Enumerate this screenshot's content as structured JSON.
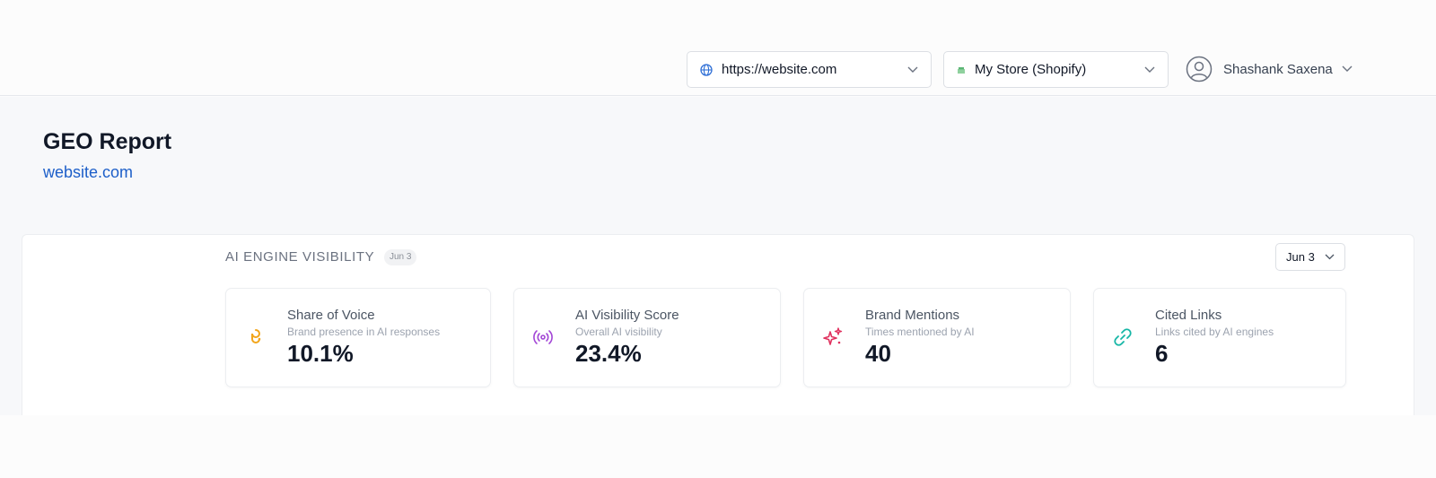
{
  "header": {
    "url_select": {
      "value": "https://website.com",
      "icon": "globe-icon"
    },
    "store_select": {
      "value": "My Store (Shopify)",
      "icon": "store-icon"
    },
    "user": {
      "name": "Shashank Saxena",
      "icon": "user-avatar-icon"
    }
  },
  "page": {
    "title": "GEO Report",
    "link": "website.com"
  },
  "visibility": {
    "title": "AI ENGINE VISIBILITY",
    "badge": "Jun 3",
    "date_filter": "Jun 3",
    "cards": [
      {
        "title": "Share of Voice",
        "subtitle": "Brand presence in AI responses",
        "value": "10.1%",
        "icon": "hook-icon",
        "color": "#f2a51a"
      },
      {
        "title": "AI Visibility Score",
        "subtitle": "Overall AI visibility",
        "value": "23.4%",
        "icon": "broadcast-icon",
        "color": "#a347d6"
      },
      {
        "title": "Brand Mentions",
        "subtitle": "Times mentioned by AI",
        "value": "40",
        "icon": "sparkles-icon",
        "color": "#e0325f"
      },
      {
        "title": "Cited Links",
        "subtitle": "Links cited by AI engines",
        "value": "6",
        "icon": "link-icon",
        "color": "#16b6a6"
      }
    ]
  },
  "colors": {
    "accent_link": "#1d5fc9",
    "text_primary": "#111827",
    "text_muted": "#6b7280"
  }
}
